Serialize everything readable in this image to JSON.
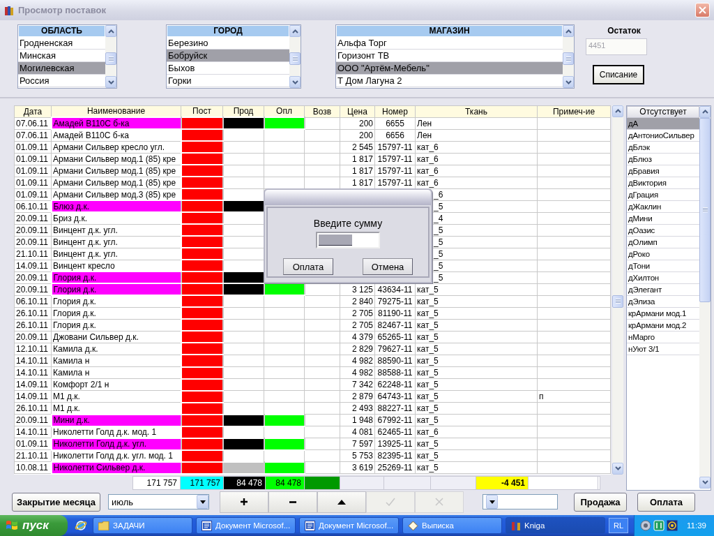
{
  "window": {
    "title": "Просмотр поставок"
  },
  "filters": [
    {
      "header": "ОБЛАСТЬ",
      "items": [
        {
          "label": "Гродненская",
          "selected": false
        },
        {
          "label": "Минская",
          "selected": false
        },
        {
          "label": "Могилевская",
          "selected": true
        },
        {
          "label": "Россия",
          "selected": false
        }
      ]
    },
    {
      "header": "ГОРОД",
      "items": [
        {
          "label": "Березино",
          "selected": false
        },
        {
          "label": "Бобруйск",
          "selected": true
        },
        {
          "label": "Быхов",
          "selected": false
        },
        {
          "label": "Горки",
          "selected": false
        }
      ]
    },
    {
      "header": "МАГАЗИН",
      "items": [
        {
          "label": "Альфа Торг",
          "selected": false
        },
        {
          "label": "Горизонт ТВ",
          "selected": false
        },
        {
          "label": "ООО \"Артём-Мебель\"",
          "selected": true
        },
        {
          "label": "Т Дом Лагуна 2",
          "selected": false
        }
      ]
    }
  ],
  "remainder": {
    "label": "Остаток",
    "value": "4451",
    "disabled": true
  },
  "writeoff_button": "Списание",
  "table": {
    "columns": [
      "Дата",
      "Наименование",
      "Пост",
      "Прод",
      "Опл",
      "Возв",
      "Цена",
      "Номер",
      "Ткань",
      "Примеч-ие"
    ],
    "rows": [
      {
        "date": "07.06.11",
        "name": "Амадей В110С б-ка",
        "highlight": true,
        "post": {
          "color": "#ff0000"
        },
        "prod": {
          "color": "#000000"
        },
        "opl": {
          "color": "#00ff00"
        },
        "price": "200",
        "number": "6655",
        "fabric": "Лен"
      },
      {
        "date": "07.06.11",
        "name": "Амадей В110С б-ка",
        "highlight": false,
        "post": {
          "color": "#ff0000"
        },
        "price": "200",
        "number": "6656",
        "fabric": "Лен"
      },
      {
        "date": "01.09.11",
        "name": "Армани Сильвер кресло угл.",
        "highlight": false,
        "post": {
          "color": "#ff0000"
        },
        "price": "2 545",
        "number": "15797-11",
        "fabric": "кат_6"
      },
      {
        "date": "01.09.11",
        "name": "Армани Сильвер мод.1 (85) кре",
        "highlight": false,
        "post": {
          "color": "#ff0000"
        },
        "price": "1 817",
        "number": "15797-11",
        "fabric": "кат_6"
      },
      {
        "date": "01.09.11",
        "name": "Армани Сильвер мод.1 (85) кре",
        "highlight": false,
        "post": {
          "color": "#ff0000"
        },
        "price": "1 817",
        "number": "15797-11",
        "fabric": "кат_6"
      },
      {
        "date": "01.09.11",
        "name": "Армани Сильвер мод.1 (85) кре",
        "highlight": false,
        "post": {
          "color": "#ff0000"
        },
        "price": "1 817",
        "number": "15797-11",
        "fabric": "кат_6"
      },
      {
        "date": "01.09.11",
        "name": "Армани Сильвер мод.3 (85) кре",
        "highlight": false,
        "post": {
          "color": "#ff0000"
        },
        "fabric": "_6",
        "fabric_cut": true
      },
      {
        "date": "06.10.11",
        "name": "Блюз д.к.",
        "highlight": true,
        "post": {
          "color": "#ff0000"
        },
        "prod": {
          "color": "#000000"
        },
        "fabric": "_5",
        "fabric_cut": true
      },
      {
        "date": "20.09.11",
        "name": "Бриз д.к.",
        "highlight": false,
        "post": {
          "color": "#ff0000"
        },
        "fabric": "_4",
        "fabric_cut": true
      },
      {
        "date": "20.09.11",
        "name": "Винцент д.к. угл.",
        "highlight": false,
        "post": {
          "color": "#ff0000"
        },
        "fabric": "_5",
        "fabric_cut": true
      },
      {
        "date": "20.09.11",
        "name": "Винцент д.к. угл.",
        "highlight": false,
        "post": {
          "color": "#ff0000"
        },
        "fabric": "_5",
        "fabric_cut": true
      },
      {
        "date": "21.10.11",
        "name": "Винцент д.к. угл.",
        "highlight": false,
        "post": {
          "color": "#ff0000"
        },
        "fabric": "_5",
        "fabric_cut": true
      },
      {
        "date": "14.09.11",
        "name": "Винцент кресло",
        "highlight": false,
        "post": {
          "color": "#ff0000"
        },
        "fabric": "_5",
        "fabric_cut": true
      },
      {
        "date": "20.09.11",
        "name": "Глория д.к.",
        "highlight": true,
        "post": {
          "color": "#ff0000"
        },
        "prod": {
          "color": "#000000"
        },
        "fabric": "_5",
        "fabric_cut": true
      },
      {
        "date": "20.09.11",
        "name": "Глория д.к.",
        "highlight": true,
        "post": {
          "color": "#ff0000"
        },
        "prod": {
          "color": "#000000"
        },
        "opl": {
          "color": "#00ff00"
        },
        "price": "3 125",
        "number": "43634-11",
        "fabric": "кат_5"
      },
      {
        "date": "06.10.11",
        "name": "Глория д.к.",
        "highlight": false,
        "post": {
          "color": "#ff0000"
        },
        "price": "2 840",
        "number": "79275-11",
        "fabric": "кат_5"
      },
      {
        "date": "26.10.11",
        "name": "Глория д.к.",
        "highlight": false,
        "post": {
          "color": "#ff0000"
        },
        "price": "2 705",
        "number": "81190-11",
        "fabric": "кат_5"
      },
      {
        "date": "26.10.11",
        "name": "Глория д.к.",
        "highlight": false,
        "post": {
          "color": "#ff0000"
        },
        "price": "2 705",
        "number": "82467-11",
        "fabric": "кат_5"
      },
      {
        "date": "20.09.11",
        "name": "Джовани Сильвер д.к.",
        "highlight": false,
        "post": {
          "color": "#ff0000"
        },
        "price": "4 379",
        "number": "65265-11",
        "fabric": "кат_5"
      },
      {
        "date": "12.10.11",
        "name": "Камила д.к.",
        "highlight": false,
        "post": {
          "color": "#ff0000"
        },
        "price": "2 829",
        "number": "79627-11",
        "fabric": "кат_5"
      },
      {
        "date": "14.10.11",
        "name": "Камила н",
        "highlight": false,
        "post": {
          "color": "#ff0000"
        },
        "price": "4 982",
        "number": "88590-11",
        "fabric": "кат_5"
      },
      {
        "date": "14.10.11",
        "name": "Камила н",
        "highlight": false,
        "post": {
          "color": "#ff0000"
        },
        "price": "4 982",
        "number": "88588-11",
        "fabric": "кат_5"
      },
      {
        "date": "14.09.11",
        "name": "Комфорт 2/1 н",
        "highlight": false,
        "post": {
          "color": "#ff0000"
        },
        "price": "7 342",
        "number": "62248-11",
        "fabric": "кат_5"
      },
      {
        "date": "14.09.11",
        "name": "М1 д.к.",
        "highlight": false,
        "post": {
          "color": "#ff0000"
        },
        "price": "2 879",
        "number": "64743-11",
        "fabric": "кат_5",
        "note": "п"
      },
      {
        "date": "26.10.11",
        "name": "М1 д.к.",
        "highlight": false,
        "post": {
          "color": "#ff0000"
        },
        "price": "2 493",
        "number": "88227-11",
        "fabric": "кат_5"
      },
      {
        "date": "20.09.11",
        "name": "Мини д.к.",
        "highlight": true,
        "post": {
          "color": "#ff0000"
        },
        "prod": {
          "color": "#000000"
        },
        "opl": {
          "color": "#00ff00"
        },
        "price": "1 948",
        "number": "67992-11",
        "fabric": "кат_5"
      },
      {
        "date": "14.10.11",
        "name": "Николетти Голд д.к. мод. 1",
        "highlight": false,
        "post": {
          "color": "#ff0000"
        },
        "price": "4 081",
        "number": "62465-11",
        "fabric": "кат_6"
      },
      {
        "date": "01.09.11",
        "name": "Николетти Голд д.к. угл.",
        "highlight": true,
        "post": {
          "color": "#ff0000"
        },
        "prod": {
          "color": "#000000"
        },
        "opl": {
          "color": "#00ff00"
        },
        "price": "7 597",
        "number": "13925-11",
        "fabric": "кат_5"
      },
      {
        "date": "21.10.11",
        "name": "Николетти Голд д.к. угл. мод. 1",
        "highlight": false,
        "post": {
          "color": "#ff0000"
        },
        "price": "5 753",
        "number": "82395-11",
        "fabric": "кат_5"
      },
      {
        "date": "10.08.11",
        "name": "Николетти Сильвер д.к.",
        "highlight": true,
        "post": {
          "color": "#ff0000"
        },
        "prod": {
          "color": "#c0c0c0"
        },
        "opl": {
          "color": "#00ff00"
        },
        "price": "3 619",
        "number": "25269-11",
        "fabric": "кат_5"
      }
    ]
  },
  "totals": [
    {
      "text": "171 757",
      "color": "#ffffff"
    },
    {
      "text": "171 757",
      "color": "#00ffff"
    },
    {
      "text": "84 478",
      "color": "#000000"
    },
    {
      "text": "84 478",
      "color": "#00ff00"
    },
    {
      "color": "#009900"
    },
    {
      "color": "#eeeef6"
    },
    {
      "color": "#eeeef6"
    },
    {
      "color": "#eeeef6"
    },
    {
      "text": "-4 451",
      "color": "#ffff00",
      "bold": true
    },
    {
      "color": "#ffffff"
    }
  ],
  "absent_list": {
    "header": "Отсутствует",
    "items": [
      {
        "label": "дА",
        "selected": true
      },
      {
        "label": "дАнтониоСильвер",
        "selected": false
      },
      {
        "label": "дБлэк",
        "selected": false
      },
      {
        "label": "дБлюз",
        "selected": false
      },
      {
        "label": "дБравия",
        "selected": false
      },
      {
        "label": "дВиктория",
        "selected": false
      },
      {
        "label": "дГрация",
        "selected": false
      },
      {
        "label": "дЖаклин",
        "selected": false
      },
      {
        "label": "дМини",
        "selected": false
      },
      {
        "label": "дОазис",
        "selected": false
      },
      {
        "label": "дОлимп",
        "selected": false
      },
      {
        "label": "дРоко",
        "selected": false
      },
      {
        "label": "дТони",
        "selected": false
      },
      {
        "label": "дХилтон",
        "selected": false
      },
      {
        "label": "дЭлегант",
        "selected": false
      },
      {
        "label": "дЭлиза",
        "selected": false
      },
      {
        "label": "крАрмани мод.1",
        "selected": false
      },
      {
        "label": "крАрмани мод.2",
        "selected": false
      },
      {
        "label": "нМарго",
        "selected": false
      },
      {
        "label": "нУют 3/1",
        "selected": false
      }
    ]
  },
  "toolbar": {
    "close_month_button": "Закрытие месяца",
    "month": "июль",
    "tools": [
      {
        "kind": "plus",
        "disabled": false
      },
      {
        "kind": "minus",
        "disabled": false
      },
      {
        "kind": "up",
        "disabled": false
      },
      {
        "kind": "check",
        "disabled": true
      },
      {
        "kind": "cross",
        "disabled": true
      }
    ],
    "sale_button": "Продажа",
    "pay_button": "Оплата"
  },
  "dialog": {
    "prompt": "Введите сумму",
    "buttons": [
      "Оплата",
      "Отмена"
    ]
  },
  "taskbar": {
    "start": "пуск",
    "tasks": [
      {
        "label": "ЗАДАЧИ",
        "kind": "folder",
        "selected": false
      },
      {
        "label": "Документ Microsof...",
        "kind": "word",
        "selected": false
      },
      {
        "label": "Документ Microsof...",
        "kind": "word",
        "selected": false
      },
      {
        "label": "Выписка",
        "kind": "diamond",
        "selected": false
      },
      {
        "label": "Kniga",
        "kind": "books",
        "selected": true
      }
    ],
    "language": "RL",
    "clock": "11:39"
  }
}
